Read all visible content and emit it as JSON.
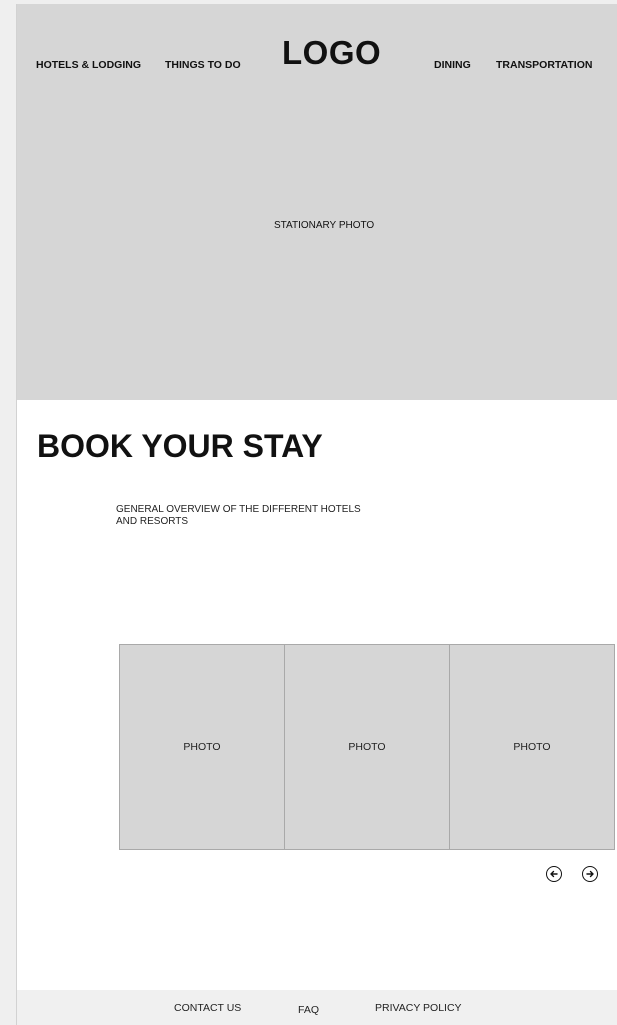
{
  "header": {
    "nav_left": [
      "HOTELS & LODGING",
      "THINGS TO DO"
    ],
    "logo": "LOGO",
    "nav_right": [
      "DINING",
      "TRANSPORTATION"
    ]
  },
  "hero": {
    "caption": "STATIONARY PHOTO"
  },
  "booking": {
    "title": "BOOK YOUR STAY",
    "overview_line1": "GENERAL OVERVIEW OF THE DIFFERENT HOTELS",
    "overview_line2": "AND RESORTS"
  },
  "gallery": {
    "photos": [
      "PHOTO",
      "PHOTO",
      "PHOTO"
    ],
    "prev_icon": "arrow-left-circle-icon",
    "next_icon": "arrow-right-circle-icon"
  },
  "footer": {
    "links": [
      "CONTACT US",
      "FAQ",
      "PRIVACY POLICY"
    ]
  },
  "colors": {
    "placeholder_gray": "#d6d6d6",
    "footer_bg": "#f0f0f0",
    "text": "#111111"
  }
}
